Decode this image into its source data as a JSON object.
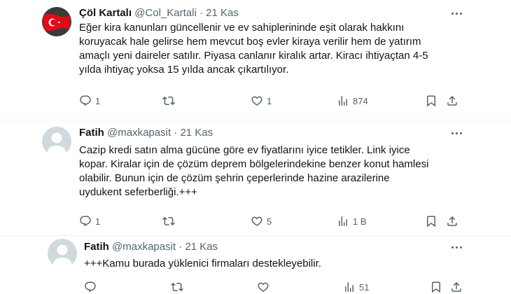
{
  "tweets": [
    {
      "name": "Çöl Kartalı",
      "handle": "@Col_Kartali",
      "separator": "·",
      "date": "21 Kas",
      "lines": [
        "Eğer kira kanunları güncellenir ve ev sahiplerininde eşit olarak hakkını",
        "koruyacak hale gelirse hem mevcut boş evler kiraya verilir hem de yatırım",
        "amaçlı yeni daireler satılır. Piyasa canlanır kiralık artar. Kiracı ihtiyaçtan 4-5",
        "yılda ihtiyaç yoksa 15 yılda ancak çıkartılıyor."
      ],
      "actions": {
        "replies": "1",
        "retweets": "",
        "likes": "1",
        "views": "874"
      }
    },
    {
      "name": "Fatih",
      "handle": "@maxkapasit",
      "separator": "·",
      "date": "21 Kas",
      "lines": [
        "Cazip kredi satın alma gücüne göre ev fiyatlarını iyice tetikler. Link iyice",
        "kopar. Kiralar için de çözüm deprem bölgelerindekine benzer konut hamlesi",
        "olabilir. Bunun için de çözüm şehrin çeperlerinde hazine arazilerine",
        "uydukent seferberliği.+++"
      ],
      "actions": {
        "replies": "1",
        "retweets": "",
        "likes": "5",
        "views": "1 B"
      }
    },
    {
      "name": "Fatih",
      "handle": "@maxkapasit",
      "separator": "·",
      "date": "21 Kas",
      "lines": [
        "+++Kamu burada yüklenici firmaları destekleyebilir."
      ],
      "actions": {
        "replies": "",
        "retweets": "",
        "likes": "",
        "views": "51"
      }
    }
  ],
  "icons": [
    "flag-avatar",
    "default-avatar",
    "reply-icon",
    "retweet-icon",
    "like-icon",
    "views-icon",
    "bookmark-icon",
    "share-icon",
    "more-icon"
  ],
  "colors": {
    "text": "#0f1419",
    "muted": "#536471",
    "divider": "#eff3f4",
    "flag_red": "#e30a17",
    "avatar_gray": "#cfd9de"
  }
}
